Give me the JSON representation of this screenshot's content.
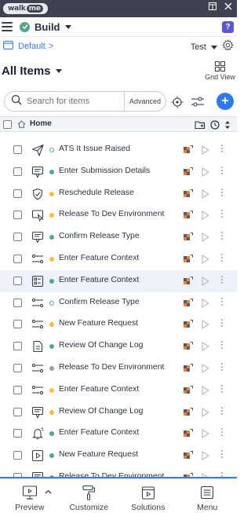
{
  "window": {
    "brand_text": "walk",
    "brand_badge": "me"
  },
  "topbar": {
    "environment": "Build",
    "help_label": "?"
  },
  "breadcrumb": {
    "folder": "Default",
    "separator": ">",
    "env_select": "Test"
  },
  "header": {
    "title": "All Items",
    "grid_view_label": "Grid View"
  },
  "search": {
    "placeholder": "Search for items",
    "advanced_label": "Advanced",
    "add_label": "+"
  },
  "list_header": {
    "label": "Home"
  },
  "items": [
    {
      "name": "ATS It Issue Raised",
      "icon": "paper-plane-icon",
      "status": "hollow"
    },
    {
      "name": "Enter Submission Details",
      "icon": "smart-tip-icon",
      "status": "green"
    },
    {
      "name": "Reschedule Release",
      "icon": "shield-check-icon",
      "status": "yellow"
    },
    {
      "name": "Release To Dev Environment",
      "icon": "launcher-icon",
      "status": "yellow"
    },
    {
      "name": "Confirm Release Type",
      "icon": "smart-tip-icon",
      "status": "green"
    },
    {
      "name": "Enter Feature Context",
      "icon": "sequence-icon",
      "status": "yellow"
    },
    {
      "name": "Enter Feature Context",
      "icon": "checklist-icon",
      "status": "green"
    },
    {
      "name": "Confirm Release Type",
      "icon": "sequence-icon",
      "status": "hollow"
    },
    {
      "name": "New Feature Request",
      "icon": "sequence-icon",
      "status": "yellow"
    },
    {
      "name": "Review Of Change Log",
      "icon": "document-icon",
      "status": "green"
    },
    {
      "name": "Release To Dev Environment",
      "icon": "sequence-icon",
      "status": "grey"
    },
    {
      "name": "Enter Feature Context",
      "icon": "sequence-icon",
      "status": "yellow"
    },
    {
      "name": "Review Of Change Log",
      "icon": "smart-tip-icon",
      "status": "yellow"
    },
    {
      "name": "Enter Feature Context",
      "icon": "bell-icon",
      "status": "green"
    },
    {
      "name": "New Feature Request",
      "icon": "play-video-icon",
      "status": "green"
    },
    {
      "name": "Release To Dev Environment",
      "icon": "smart-tip-icon",
      "status": "green"
    }
  ],
  "highlighted_row": 6,
  "bottom_tabs": [
    {
      "label": "Preview",
      "icon": "monitor-icon"
    },
    {
      "label": "Customize",
      "icon": "paint-roller-icon"
    },
    {
      "label": "Solutions",
      "icon": "solutions-icon"
    },
    {
      "label": "Menu",
      "icon": "menu-icon"
    }
  ],
  "colors": {
    "titlebar": "#3f4351",
    "accent": "#2e7ae6",
    "published": "#56a589",
    "draft": "#f2c036",
    "help": "#5b56d6"
  }
}
